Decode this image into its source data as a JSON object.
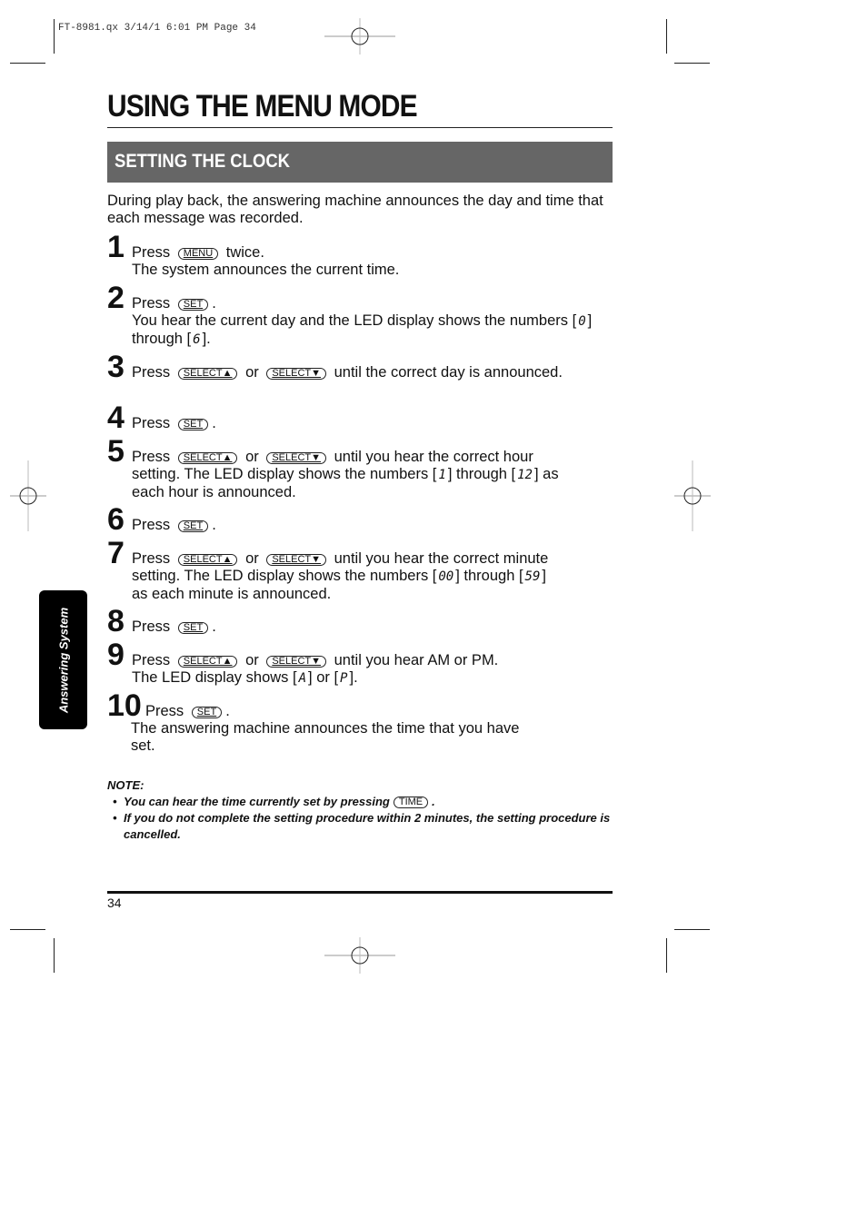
{
  "slug": "FT-8981.qx  3/14/1  6:01 PM  Page 34",
  "title": "USING THE MENU MODE",
  "section_title": "SETTING THE CLOCK",
  "intro": "During play back, the answering machine announces the day and time that each message was recorded.",
  "keys": {
    "menu": "MENU",
    "set": "SET",
    "select_up": "SELECT▲",
    "select_down": "SELECT▼",
    "time": "TIME"
  },
  "words": {
    "press": "Press",
    "or": "or"
  },
  "steps": [
    {
      "num": "1",
      "after_key": "twice.",
      "line2": "The system announces the current time."
    },
    {
      "num": "2",
      "after_key": ".",
      "line2a": "You hear the current day and the LED display shows the numbers [",
      "led_a": "0",
      "mid": "] through [",
      "led_b": "6",
      "end": "]."
    },
    {
      "num": "3",
      "after_keys": "until the correct day is announced."
    },
    {
      "num": "4",
      "after_key": "."
    },
    {
      "num": "5",
      "after_keys": "until you hear the correct hour setting. The LED display shows the numbers [",
      "led_a": "1",
      "mid": "] through [",
      "led_b": "12",
      "end": "] as each hour is announced."
    },
    {
      "num": "6",
      "after_key": "."
    },
    {
      "num": "7",
      "after_keys": "until you hear the correct minute setting. The LED display shows the numbers [",
      "led_a": "00",
      "mid": "] through [",
      "led_b": "59",
      "end": "] as each minute is announced."
    },
    {
      "num": "8",
      "after_key": "."
    },
    {
      "num": "9",
      "after_keys": "until you hear AM or PM.",
      "line2a": "The LED display shows [",
      "led_a": "A",
      "mid": "] or [",
      "led_b": "P",
      "end": "]."
    },
    {
      "num": "10",
      "after_key": ".",
      "line2": "The answering machine announces the time that you have set."
    }
  ],
  "note": {
    "label": "NOTE:",
    "item1_pre": "You can hear the time currently set by pressing",
    "item1_post": ".",
    "item2": "If you do not complete the setting procedure within 2 minutes, the setting procedure is cancelled."
  },
  "page_number": "34",
  "side_tab": "Answering System"
}
